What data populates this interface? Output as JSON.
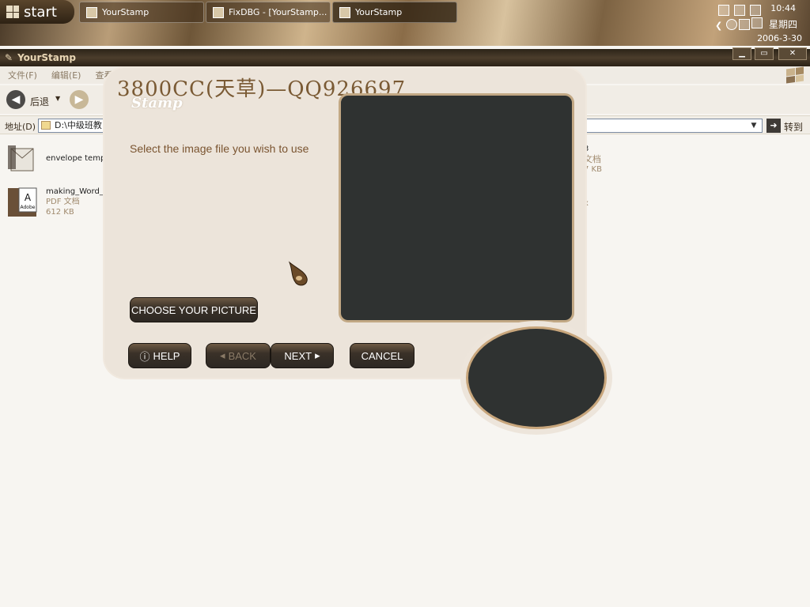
{
  "taskbar": {
    "start_label": "start",
    "tasks": [
      {
        "label": "YourStamp"
      },
      {
        "label": "FixDBG - [YourStamp..."
      },
      {
        "label": "YourStamp"
      }
    ],
    "clock": {
      "time": "10:44",
      "day": "星期四",
      "date": "2006-3-30"
    }
  },
  "explorer": {
    "title": "YourStamp",
    "menu": [
      "文件(F)",
      "编辑(E)",
      "查看"
    ],
    "back_label": "后退",
    "address_label": "地址(D)",
    "address_value": "D:\\中级班教",
    "go_label": "转到",
    "files": [
      {
        "name": "envelope templ",
        "type": "",
        "size": ""
      },
      {
        "name": "making_Word_",
        "type": "PDF 文档",
        "size": "612 KB"
      }
    ],
    "right_column": {
      "name_fragment": "3",
      "type": "文档",
      "size": "7 KB",
      "extra": "x"
    }
  },
  "dialog": {
    "title": "3800CC(天草)—QQ926697",
    "subtitle": "Stamp",
    "instruction": "Select the image file you wish to use",
    "choose_button": "CHOOSE YOUR PICTURE",
    "help_button": "HELP",
    "back_button": "BACK",
    "next_button": "NEXT",
    "cancel_button": "CANCEL"
  },
  "colors": {
    "preview_bg": "#2f3231",
    "dialog_bg": "#ece4da",
    "accent": "#7a5a34"
  }
}
